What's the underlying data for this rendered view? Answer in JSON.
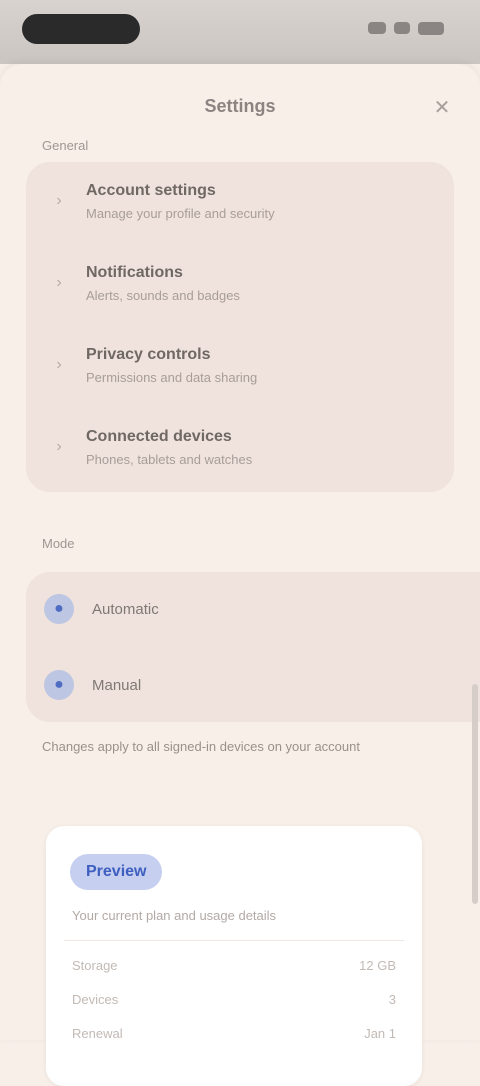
{
  "header": {
    "title": "Settings",
    "close_icon": "close-icon"
  },
  "section_top": {
    "label": "General"
  },
  "options": [
    {
      "title": "Account settings",
      "subtitle": "Manage your profile and security"
    },
    {
      "title": "Notifications",
      "subtitle": "Alerts, sounds and badges"
    },
    {
      "title": "Privacy controls",
      "subtitle": "Permissions and data sharing"
    },
    {
      "title": "Connected devices",
      "subtitle": "Phones, tablets and watches"
    }
  ],
  "section_mode": {
    "label": "Mode"
  },
  "mode_options": [
    {
      "title": "Automatic",
      "selected": true
    },
    {
      "title": "Manual",
      "selected": false
    }
  ],
  "note": {
    "text": "Changes apply to all signed-in devices on your account"
  },
  "card": {
    "badge": "Preview",
    "description": "Your current plan and usage details",
    "lines": [
      {
        "key": "Storage",
        "value": "12 GB"
      },
      {
        "key": "Devices",
        "value": "3"
      },
      {
        "key": "Renewal",
        "value": "Jan 1"
      }
    ]
  },
  "colors": {
    "accent": "#3e5fc0",
    "group_bg": "#f0e3dd",
    "page_bg": "#f8efe8"
  }
}
